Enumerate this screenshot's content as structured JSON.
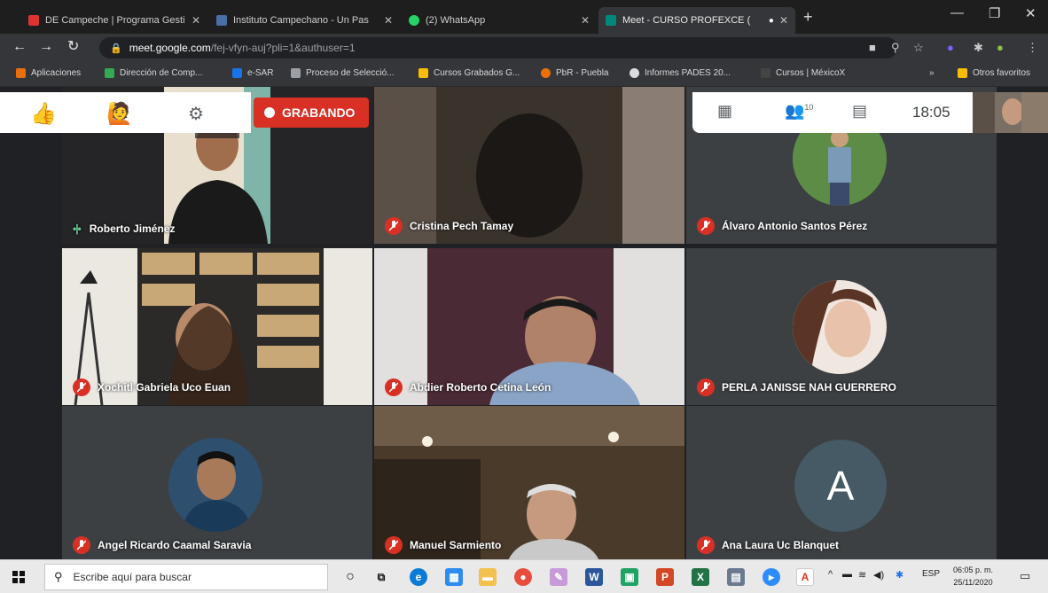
{
  "browser": {
    "tabs": [
      {
        "title": "DE Campeche | Programa Gesti",
        "icon": "bookmark-icon",
        "color": "#d33"
      },
      {
        "title": "Instituto Campechano - Un Pas",
        "icon": "page-icon",
        "color": "#4a6fa5"
      },
      {
        "title": "(2) WhatsApp",
        "icon": "whatsapp-icon",
        "color": "#25d366"
      },
      {
        "title": "Meet - CURSO PROFEXCE (",
        "icon": "meet-icon",
        "color": "#00897b"
      }
    ],
    "url_domain": "meet.google.com",
    "url_path": "/fej-vfyn-auj?pli=1&authuser=1",
    "bookmarks": [
      {
        "label": "Aplicaciones",
        "color": "#e8710a"
      },
      {
        "label": "Dirección de Comp...",
        "color": "#34a853"
      },
      {
        "label": "e-SAR",
        "color": "#1a73e8"
      },
      {
        "label": "Proceso de Selecció...",
        "color": "#9aa0a6"
      },
      {
        "label": "Cursos Grabados G...",
        "color": "#fbbc04"
      },
      {
        "label": "PbR - Puebla",
        "color": "#e8710a"
      },
      {
        "label": "Informes PADES 20...",
        "color": "#dadce0"
      },
      {
        "label": "Cursos | MéxicoX",
        "color": "#444"
      },
      {
        "label": "Otros favoritos",
        "color": "#fbbc04"
      }
    ]
  },
  "meet": {
    "recording_label": "GRABANDO",
    "time": "18:05",
    "participants_count": "10",
    "participants": [
      {
        "name": "Roberto Jiménez",
        "muted": false,
        "speaking": true
      },
      {
        "name": "Cristina Pech Tamay",
        "muted": true
      },
      {
        "name": "Álvaro Antonio Santos Pérez",
        "muted": true
      },
      {
        "name": "Xochitl Gabriela Uco Euan",
        "muted": true
      },
      {
        "name": "Abdier Roberto Cetina León",
        "muted": true
      },
      {
        "name": "PERLA JANISSE NAH GUERRERO",
        "muted": true
      },
      {
        "name": "Angel Ricardo Caamal Saravia",
        "muted": true
      },
      {
        "name": "Manuel Sarmiento",
        "muted": true
      },
      {
        "name": "Ana Laura Uc Blanquet",
        "muted": true,
        "initial": "A"
      }
    ]
  },
  "taskbar": {
    "search_placeholder": "Escribe aquí para buscar",
    "time": "06:05 p. m.",
    "date": "25/11/2020",
    "language": "ESP"
  }
}
